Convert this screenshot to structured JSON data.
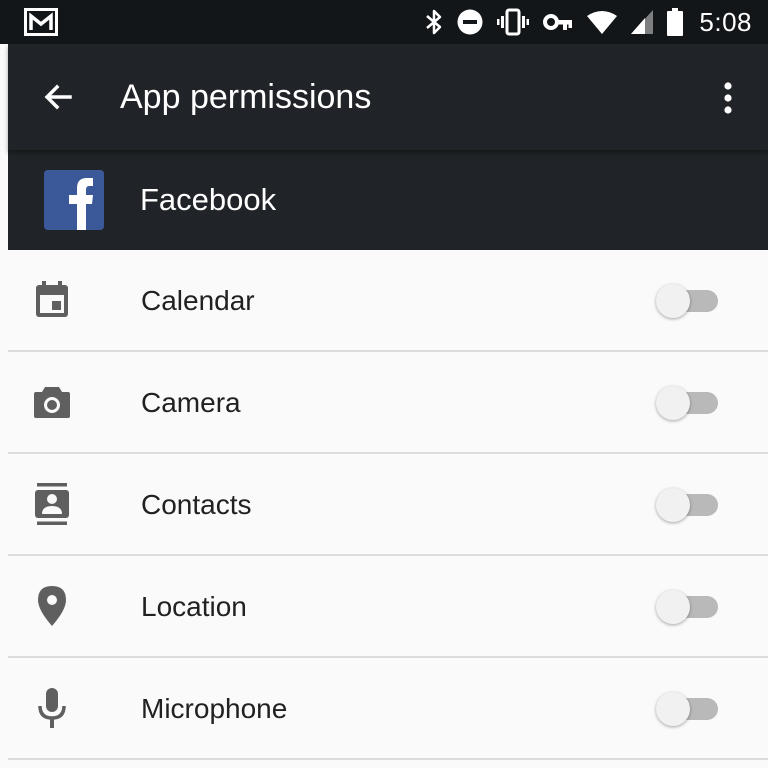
{
  "status_bar": {
    "time": "5:08",
    "icons": [
      "gmail-notification-icon",
      "bluetooth-icon",
      "do-not-disturb-icon",
      "vibrate-icon",
      "vpn-key-icon",
      "wifi-icon",
      "cell-signal-icon",
      "battery-icon"
    ]
  },
  "app_bar": {
    "title": "App permissions",
    "back_icon": "arrow-back-icon",
    "menu_icon": "more-vert-icon"
  },
  "app": {
    "name": "Facebook",
    "logo_letter": "f",
    "logo_color": "#3b5998"
  },
  "permissions": [
    {
      "label": "Calendar",
      "icon": "calendar-icon",
      "enabled": false
    },
    {
      "label": "Camera",
      "icon": "camera-icon",
      "enabled": false
    },
    {
      "label": "Contacts",
      "icon": "contacts-icon",
      "enabled": false
    },
    {
      "label": "Location",
      "icon": "location-icon",
      "enabled": false
    },
    {
      "label": "Microphone",
      "icon": "microphone-icon",
      "enabled": false
    }
  ],
  "colors": {
    "status_bar_bg": "#131619",
    "app_bar_bg": "#202327",
    "list_bg": "#fafafa",
    "icon_gray": "#5f5f5f",
    "toggle_track_off": "#b9b9b9",
    "toggle_thumb_off": "#f1f1f1"
  }
}
